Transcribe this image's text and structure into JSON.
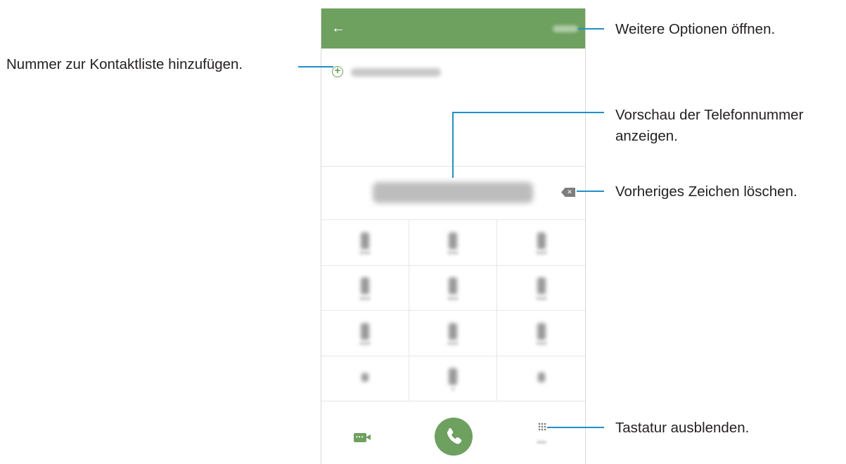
{
  "callouts": {
    "more_options": "Weitere Optionen öffnen.",
    "add_contact": "Nummer zur Kontaktliste hinzufügen.",
    "preview_line1": "Vorschau der Telefonnummer",
    "preview_line2": "anzeigen.",
    "delete_char": "Vorheriges Zeichen löschen.",
    "hide_keypad": "Tastatur ausblenden."
  },
  "phone": {
    "back_icon": "←",
    "add_icon": "+",
    "backspace_icon": "✕"
  },
  "colors": {
    "app_green": "#6ea05f",
    "callout_line": "#2090c8"
  },
  "icons": [
    "back-arrow-icon",
    "add-contact-icon",
    "backspace-icon",
    "video-call-icon",
    "phone-call-icon",
    "keypad-icon"
  ]
}
